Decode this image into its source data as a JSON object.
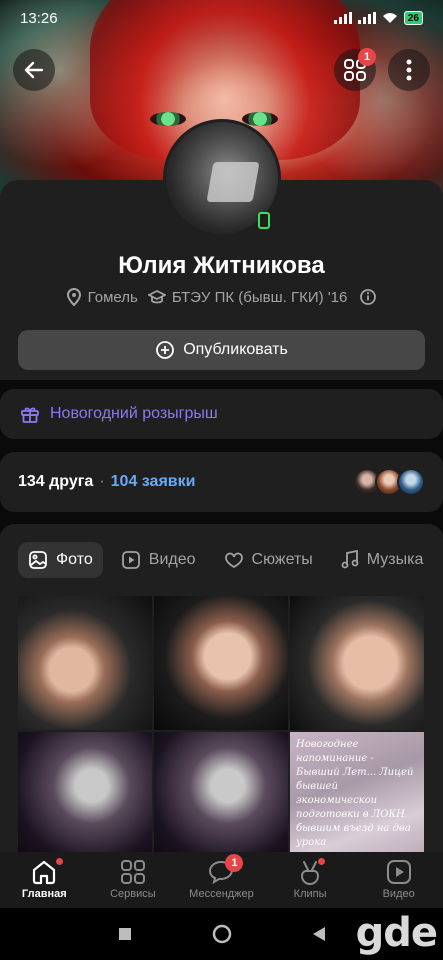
{
  "status_bar": {
    "time": "13:26",
    "battery": "26"
  },
  "header": {
    "grid_badge": "1"
  },
  "profile": {
    "name": "Юлия Житникова",
    "city": "Гомель",
    "education": "БТЭУ ПК (бывш. ГКИ) '16",
    "publish_label": "Опубликовать"
  },
  "promo": {
    "label": "Новогодний розыгрыш"
  },
  "friends": {
    "count_label": "134 друга",
    "separator": "·",
    "requests_label": "104 заявки"
  },
  "media_tabs": [
    {
      "label": "Фото",
      "icon": "photo-icon",
      "active": true
    },
    {
      "label": "Видео",
      "icon": "video-icon"
    },
    {
      "label": "Сюжеты",
      "icon": "stories-icon"
    },
    {
      "label": "Музыка",
      "icon": "music-icon"
    }
  ],
  "photo_caption": "Новогоднее напоминание - Бывший Лет... Лицей бывшей экономическои подготовки в ЛОКН бывшим въезд на два урока",
  "bottom_nav": [
    {
      "label": "Главная",
      "icon": "home-icon",
      "active": true,
      "dot": true
    },
    {
      "label": "Сервисы",
      "icon": "services-icon"
    },
    {
      "label": "Мессенджер",
      "icon": "messenger-icon",
      "badge": "1"
    },
    {
      "label": "Клипы",
      "icon": "clips-icon",
      "dot": true
    },
    {
      "label": "Видео",
      "icon": "video-nav-icon"
    }
  ],
  "watermark": "gde",
  "colors": {
    "accent_blue": "#6aa9f7",
    "promo_purple": "#8d78f0",
    "badge_red": "#e64646",
    "online_green": "#3ce05a"
  }
}
